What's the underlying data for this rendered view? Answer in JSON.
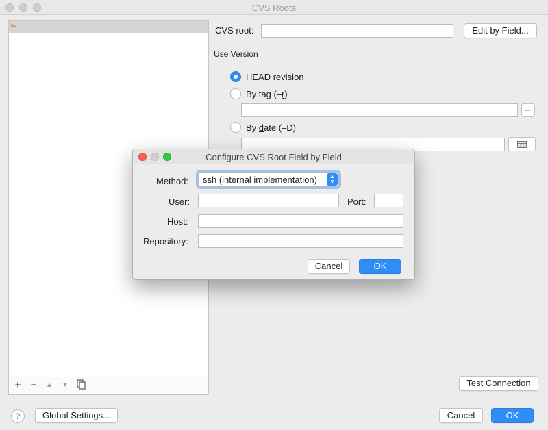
{
  "window": {
    "title": "CVS Roots"
  },
  "list": {
    "toolbar": {
      "add": "+",
      "remove": "−",
      "up": "▲",
      "down": "▼"
    }
  },
  "form": {
    "cvs_root_label": "CVS root:",
    "cvs_root_value": "",
    "edit_by_field_button": "Edit by Field...",
    "section_title": "Use Version",
    "head_revision": {
      "prefix": "H",
      "rest": "EAD revision",
      "selected": true
    },
    "by_tag": {
      "before": "By tag (–",
      "accel": "r",
      "after": ")",
      "value": "",
      "browse_label": "..."
    },
    "by_date": {
      "before": "By ",
      "accel": "d",
      "after": "ate (–D)",
      "value": ""
    },
    "test_connection_button": "Test Connection"
  },
  "footer": {
    "help_label": "?",
    "global_settings_button": "Global Settings...",
    "cancel_button": "Cancel",
    "ok_button": "OK"
  },
  "dialog": {
    "title": "Configure CVS Root Field by Field",
    "method_label": "Method:",
    "method_value": "ssh (internal implementation)",
    "user_label": "User:",
    "user_value": "",
    "port_label": "Port:",
    "port_value": "",
    "host_label": "Host:",
    "host_value": "",
    "repository_label": "Repository:",
    "repository_value": "",
    "cancel_button": "Cancel",
    "ok_button": "OK"
  },
  "colors": {
    "accent": "#2f8ef5",
    "close": "#fc605c",
    "minimize": "#fdbc40",
    "zoom": "#34c84a"
  }
}
